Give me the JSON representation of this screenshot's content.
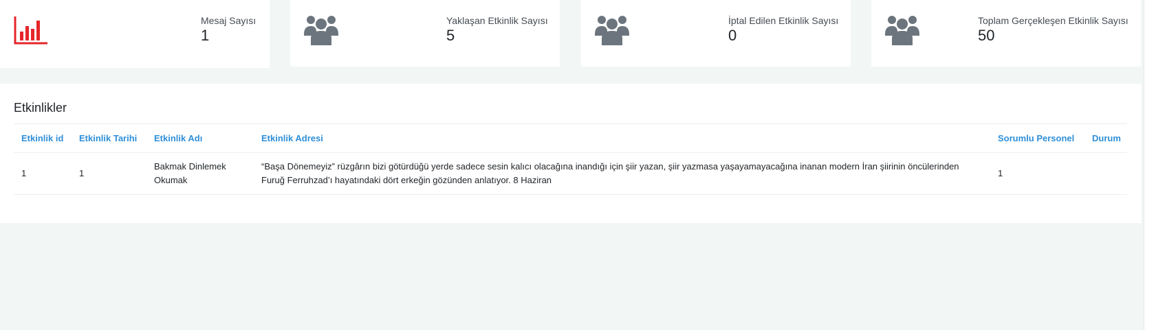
{
  "colors": {
    "page_background": "#f2f7f6",
    "card_background": "#ffffff",
    "chart_icon_red": "#e5262a",
    "users_icon_gray": "#6c757d",
    "table_header_blue": "#2f8fd8"
  },
  "stats": [
    {
      "label": "Mesaj Sayısı",
      "value": "1",
      "icon": "bar-chart-icon"
    },
    {
      "label": "Yaklaşan Etkinlik Sayısı",
      "value": "5",
      "icon": "users-icon"
    },
    {
      "label": "İptal Edilen Etkinlik Sayısı",
      "value": "0",
      "icon": "users-icon"
    },
    {
      "label": "Toplam Gerçekleşen Etkinlik Sayısı",
      "value": "50",
      "icon": "users-icon"
    }
  ],
  "events_panel": {
    "title": "Etkinlikler",
    "columns": [
      "Etkinlik id",
      "Etkinlik Tarihi",
      "Etkinlik Adı",
      "Etkinlik Adresi",
      "Sorumlu Personel",
      "Durum"
    ],
    "rows": [
      {
        "id": "1",
        "date": "1",
        "name": "Bakmak Dinlemek Okumak",
        "address": "“Başa Dönemeyiz” rüzgârın bizi götürdüğü yerde sadece sesin kalıcı olacağına inandığı için şiir yazan, şiir yazmasa yaşayamayacağına inanan modern İran şiirinin öncülerinden Furuğ Ferruhzad’ı hayatındaki dört erkeğin gözünden anlatıyor. 8 Haziran",
        "staff": "1",
        "status": ""
      }
    ]
  }
}
